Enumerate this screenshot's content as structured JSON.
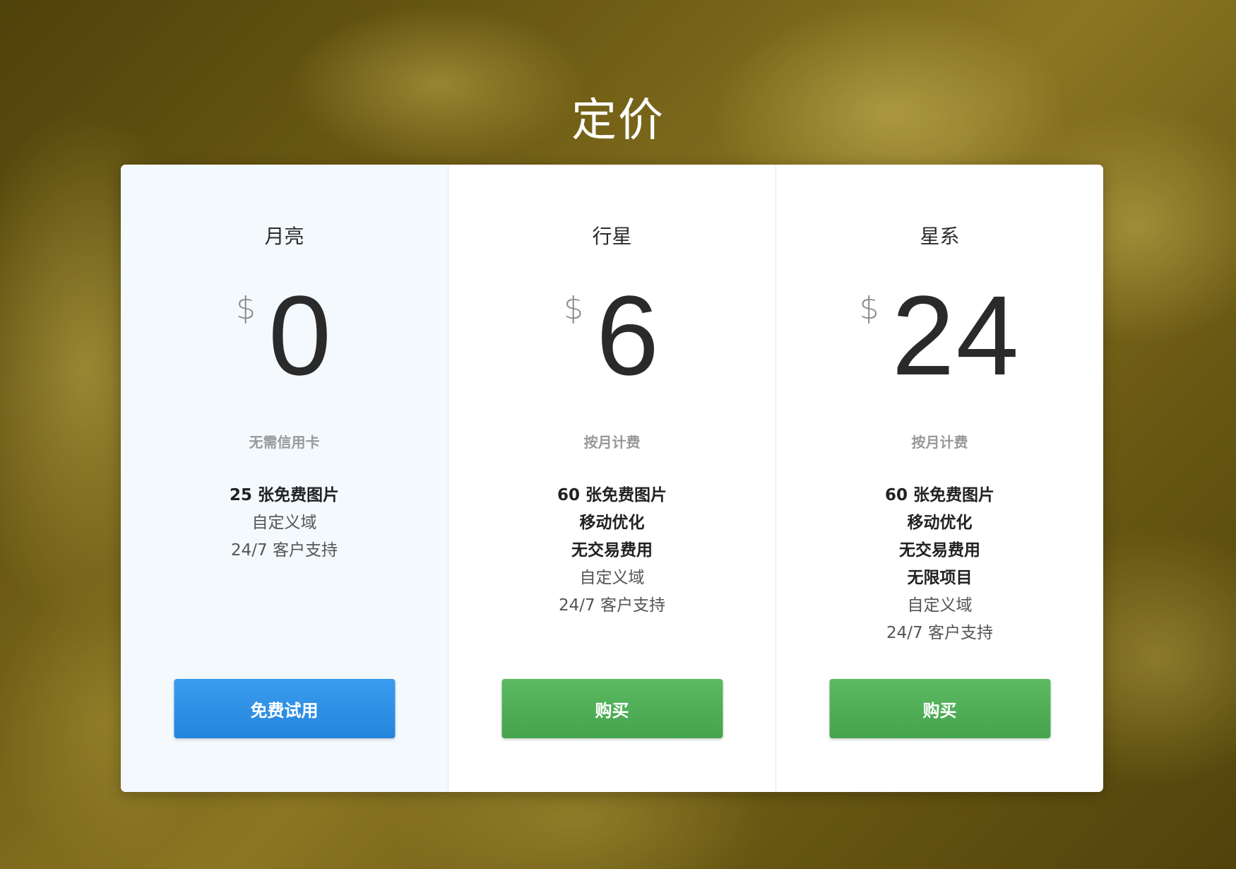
{
  "page": {
    "title": "定价"
  },
  "plans": [
    {
      "name": "月亮",
      "currency": "$",
      "price": "0",
      "note": "无需信用卡",
      "features": [
        {
          "text": "25 张免费图片",
          "bold": true
        },
        {
          "text": "自定义域",
          "bold": false
        },
        {
          "text": "24/7 客户支持",
          "bold": false
        }
      ],
      "button": "免费试用",
      "button_color": "#2e91e6",
      "highlight": true
    },
    {
      "name": "行星",
      "currency": "$",
      "price": "6",
      "note": "按月计费",
      "features": [
        {
          "text": "60 张免费图片",
          "bold": true
        },
        {
          "text": "移动优化",
          "bold": true
        },
        {
          "text": "无交易费用",
          "bold": true
        },
        {
          "text": "自定义域",
          "bold": false
        },
        {
          "text": "24/7 客户支持",
          "bold": false
        }
      ],
      "button": "购买",
      "button_color": "#4fae55",
      "highlight": false
    },
    {
      "name": "星系",
      "currency": "$",
      "price": "24",
      "note": "按月计费",
      "features": [
        {
          "text": "60 张免费图片",
          "bold": true
        },
        {
          "text": "移动优化",
          "bold": true
        },
        {
          "text": "无交易费用",
          "bold": true
        },
        {
          "text": "无限项目",
          "bold": true
        },
        {
          "text": "自定义域",
          "bold": false
        },
        {
          "text": "24/7 客户支持",
          "bold": false
        }
      ],
      "button": "购买",
      "button_color": "#4fae55",
      "highlight": false
    }
  ]
}
